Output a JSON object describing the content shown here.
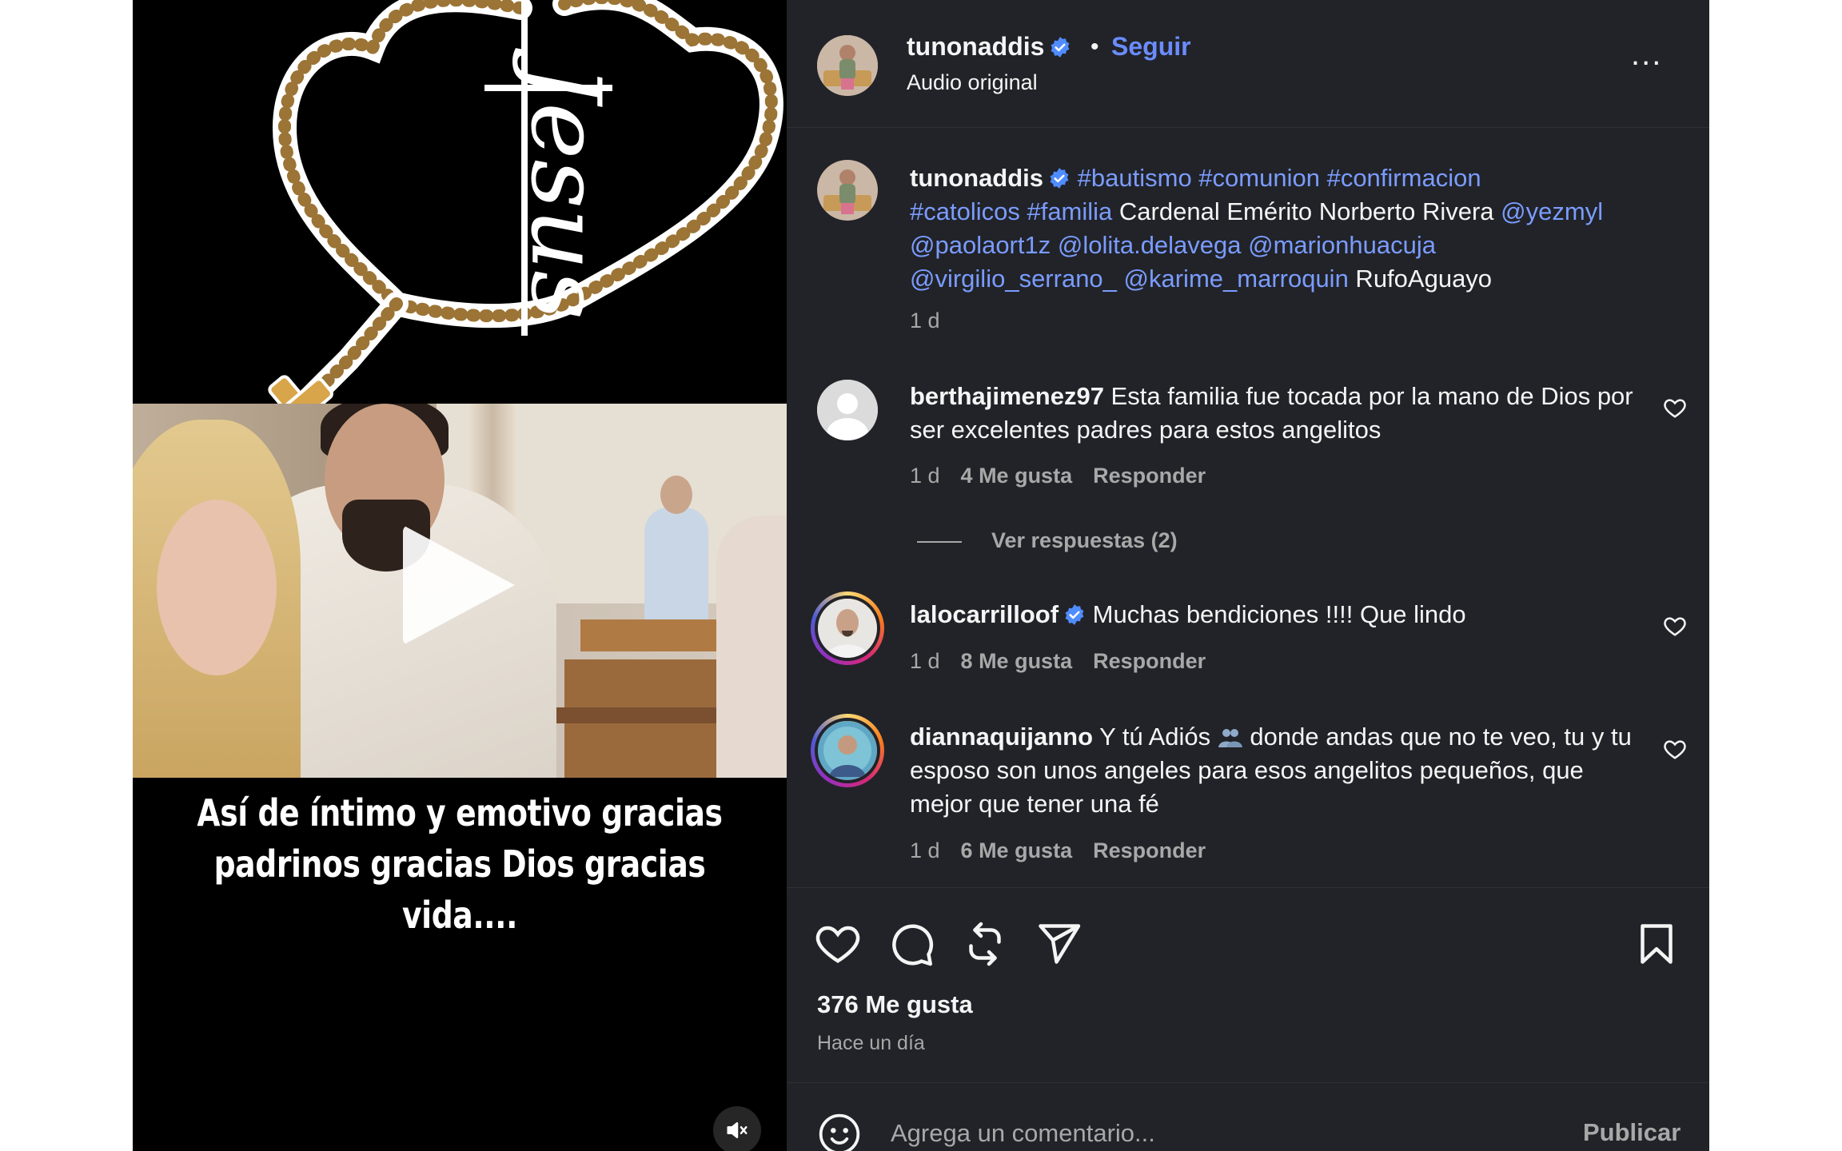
{
  "post": {
    "username": "tunonaddis",
    "follow_label": "Seguir",
    "separator": "•",
    "audio_label": "Audio original",
    "more_label": "..."
  },
  "media": {
    "caption_line1": "Así de íntimo y emotivo gracias",
    "caption_line2": "padrinos gracias Dios gracias",
    "caption_line3": "vida....",
    "rosary_text": "Jesus"
  },
  "caption": {
    "username": "tunonaddis",
    "hashtags_line1": "#bautismo #comunion #confirmacion",
    "hashtags_line2": "#catolicos #familia",
    "text_line2": " Cardenal Emérito Norberto Rivera ",
    "mention_1": "@yezmyl",
    "mention_2": "@paolaort1z @lolita.delavega @marionhuacuja",
    "mention_3": "@virgilio_serrano_ @karime_marroquin",
    "text_line4": " RufoAguayo",
    "time": "1 d"
  },
  "comments": [
    {
      "username": "berthajimenez97",
      "text": " Esta familia fue tocada por la mano de Dios por ser excelentes padres para estos angelitos",
      "time": "1 d",
      "likes": "4 Me gusta",
      "reply": "Responder"
    },
    {
      "username": "lalocarrilloof",
      "text": " Muchas bendiciones !!!! Que lindo",
      "time": "1 d",
      "likes": "8 Me gusta",
      "reply": "Responder"
    },
    {
      "username": "diannaquijanno",
      "text_a": " Y tú Adiós ",
      "text_b": " donde andas que no te veo, tu y tu esposo son unos angeles para esos angelitos pequeños, que mejor que tener una fé",
      "time": "1 d",
      "likes": "6 Me gusta",
      "reply": "Responder"
    }
  ],
  "view_replies": "Ver respuestas (2)",
  "likes_count": "376 Me gusta",
  "posted_when": "Hace un día",
  "comment_box": {
    "placeholder": "Agrega un comentario...",
    "publish_label": "Publicar"
  },
  "colors": {
    "panel_bg": "#212328",
    "link": "#6b8cff",
    "verified": "#4f8cff",
    "muted": "#a8a8a8"
  },
  "icons": [
    "verified-badge-icon",
    "more-options-icon",
    "heart-icon",
    "comment-icon",
    "repost-icon",
    "share-icon",
    "bookmark-icon",
    "emoji-icon",
    "muted-speaker-icon",
    "play-icon"
  ]
}
